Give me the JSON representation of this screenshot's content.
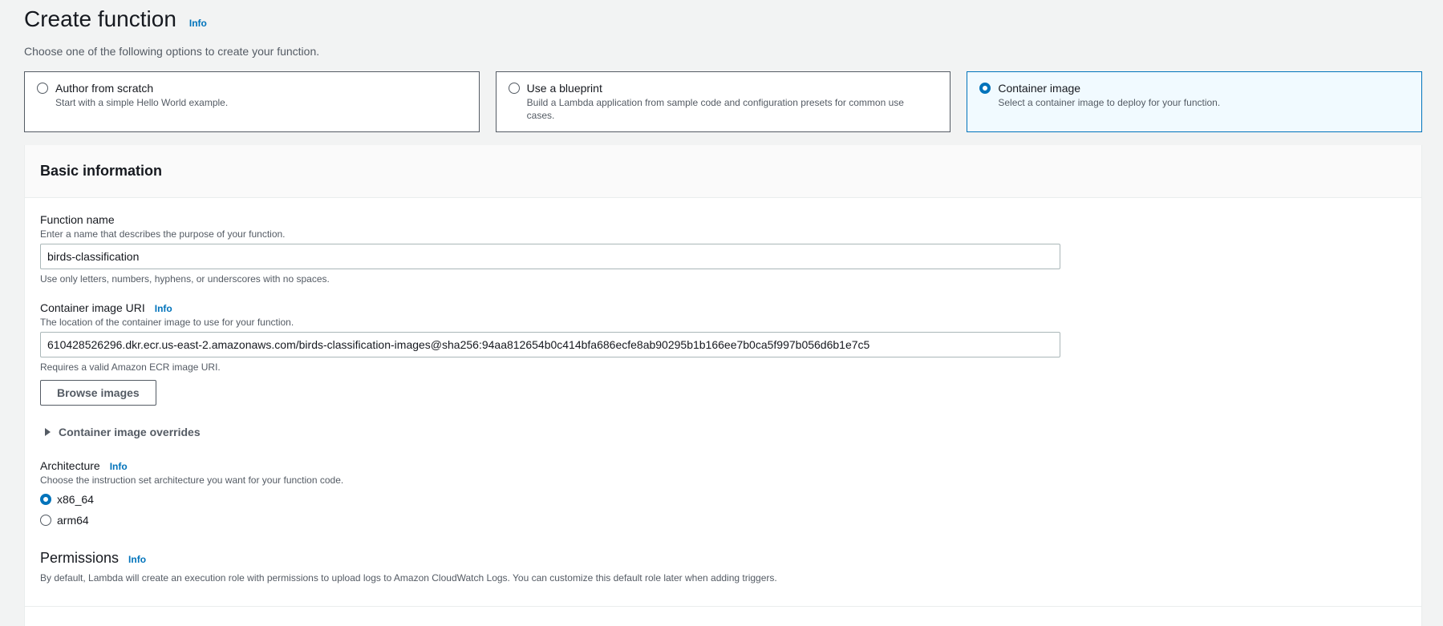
{
  "header": {
    "title": "Create function",
    "info_label": "Info",
    "subtitle": "Choose one of the following options to create your function."
  },
  "options": [
    {
      "title": "Author from scratch",
      "description": "Start with a simple Hello World example.",
      "selected": false
    },
    {
      "title": "Use a blueprint",
      "description": "Build a Lambda application from sample code and configuration presets for common use cases.",
      "selected": false
    },
    {
      "title": "Container image",
      "description": "Select a container image to deploy for your function.",
      "selected": true
    }
  ],
  "basic_info": {
    "title": "Basic information",
    "function_name": {
      "label": "Function name",
      "description": "Enter a name that describes the purpose of your function.",
      "value": "birds-classification",
      "constraint": "Use only letters, numbers, hyphens, or underscores with no spaces."
    },
    "image_uri": {
      "label": "Container image URI",
      "info_label": "Info",
      "description": "The location of the container image to use for your function.",
      "value": "610428526296.dkr.ecr.us-east-2.amazonaws.com/birds-classification-images@sha256:94aa812654b0c414bfa686ecfe8ab90295b1b166ee7b0ca5f997b056d6b1e7c5",
      "constraint": "Requires a valid Amazon ECR image URI.",
      "browse_button": "Browse images"
    },
    "overrides": {
      "label": "Container image overrides"
    },
    "architecture": {
      "label": "Architecture",
      "info_label": "Info",
      "description": "Choose the instruction set architecture you want for your function code.",
      "options": [
        {
          "label": "x86_64",
          "selected": true
        },
        {
          "label": "arm64",
          "selected": false
        }
      ]
    },
    "permissions": {
      "label": "Permissions",
      "info_label": "Info",
      "description": "By default, Lambda will create an execution role with permissions to upload logs to Amazon CloudWatch Logs. You can customize this default role later when adding triggers."
    }
  },
  "colors": {
    "accent": "#0073bb",
    "selected_bg": "#f1faff",
    "page_bg": "#f2f3f3"
  }
}
